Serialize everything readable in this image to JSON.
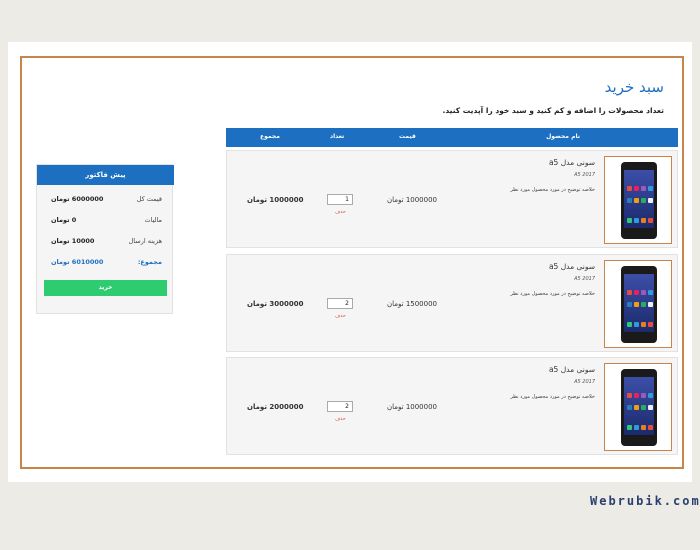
{
  "page": {
    "title": "سبد خرید",
    "subtitle": "تعداد محصولات را اضافه و کم کنید و سبد خود را آپدیت کنید."
  },
  "table": {
    "headers": {
      "name": "نام محصول",
      "price": "قیمت",
      "qty": "تعداد",
      "total": "مجموع"
    },
    "rows": [
      {
        "name": "سونی مدل a5",
        "model": "A5 2017",
        "desc": "خلاصه توضیح در مورد محصول مورد نظر",
        "price": "1000000 تومان",
        "qty": "1",
        "delete": "حذف",
        "total": "1000000 تومان",
        "image": "phone-image"
      },
      {
        "name": "سونی مدل a5",
        "model": "A5 2017",
        "desc": "خلاصه توضیح در مورد محصول مورد نظر",
        "price": "1500000 تومان",
        "qty": "2",
        "delete": "حذف",
        "total": "3000000 تومان",
        "image": "phone-image"
      },
      {
        "name": "سونی مدل a5",
        "model": "A5 2017",
        "desc": "خلاصه توضیح در مورد محصول مورد نظر",
        "price": "1000000 تومان",
        "qty": "2",
        "delete": "حذف",
        "total": "2000000 تومان",
        "image": "phone-image"
      }
    ]
  },
  "invoice": {
    "title": "پیش فاکتور",
    "rows": [
      {
        "label": "قیمت کل",
        "value": "6000000 تومان"
      },
      {
        "label": "مالیات",
        "value": "0 تومان"
      },
      {
        "label": "هزینه ارسال",
        "value": "10000 تومان"
      },
      {
        "label": "مجموع:",
        "value": "6010000 تومان"
      }
    ],
    "buy_label": "خرید"
  },
  "watermark": "Webrubik.com",
  "colors": {
    "accent": "#1d6fc1",
    "border": "#c9844c",
    "buy": "#2ecc71",
    "delete": "#d9534f"
  }
}
